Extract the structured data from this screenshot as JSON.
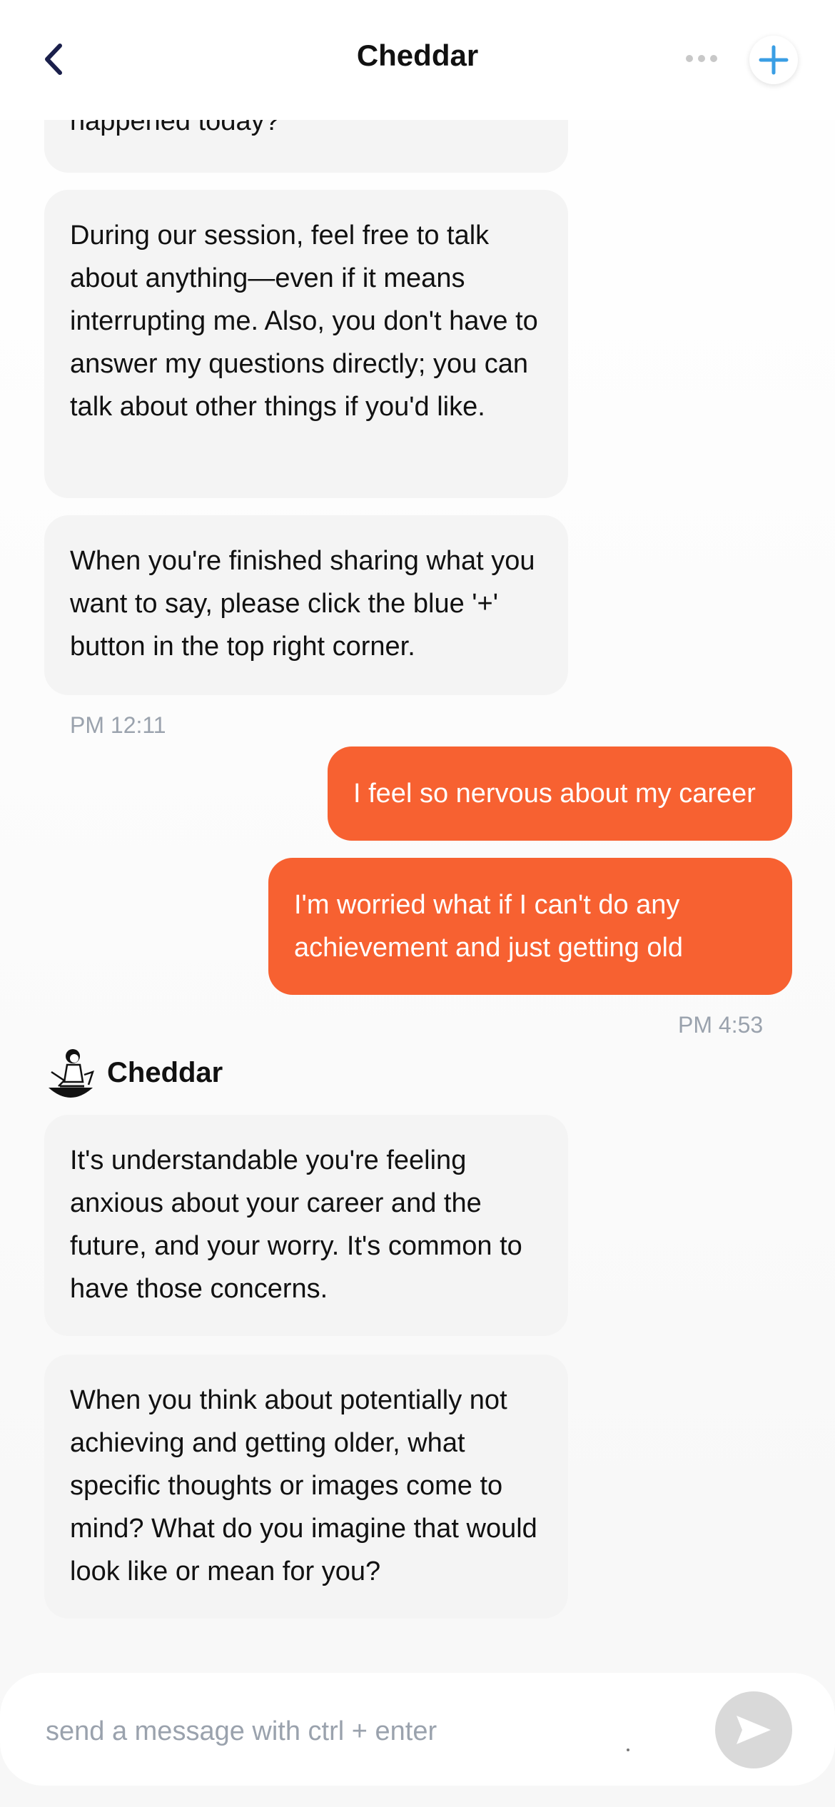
{
  "header": {
    "title": "Cheddar"
  },
  "messages": {
    "bot1": "happened today?",
    "bot2": "During our session, feel free to talk about anything—even if it means interrupting me. Also, you don't have to answer my questions directly; you can talk about other things if you'd like.",
    "bot3": "When you're finished sharing what you want to say, please click the blue '+' button in the top right corner.",
    "time1": "PM 12:11",
    "user1": "I feel so nervous about my career",
    "user2": "I'm worried what if I can't do any achievement and just getting old",
    "time2": "PM 4:53",
    "sender_name": "Cheddar",
    "bot4": "It's understandable you're feeling anxious about your career and the future, and your worry. It's common to have those concerns.",
    "bot5": "When you think about potentially not achieving and getting older, what specific thoughts or images come to mind? What do you imagine that would look like or mean for you?"
  },
  "composer": {
    "placeholder": "send a message with ctrl + enter"
  },
  "colors": {
    "accent_user_bubble": "#f76131",
    "plus_icon": "#3a9ee4",
    "back_icon": "#1a1f4b"
  }
}
